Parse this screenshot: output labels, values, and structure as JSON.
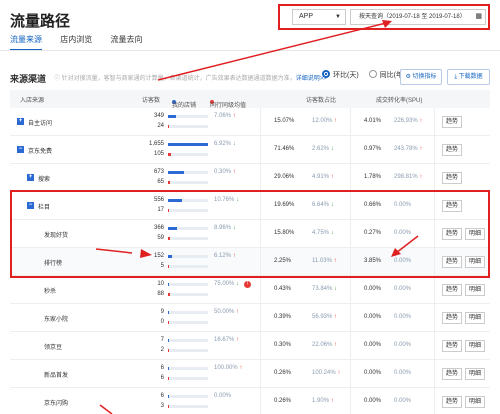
{
  "page_title": "流量路径",
  "top_controls": {
    "app_select": "APP",
    "date_range": "按天查询（2019-07-18 至 2019-07-18）"
  },
  "tabs": [
    {
      "label": "流量来源",
      "active": true
    },
    {
      "label": "店内浏览",
      "active": false
    },
    {
      "label": "流量去向",
      "active": false
    }
  ],
  "source_section": {
    "title": "来源渠道",
    "desc": "针对对搜流量，客智与商家通的计算量，各渠道统计，广告效果表达数据通道数据为准，",
    "link": "详细说明>>",
    "radio_daily": "环比(天)",
    "radio_weekly": "同比(年)",
    "btn_switch": "切换指标",
    "btn_download": "下载数据"
  },
  "table": {
    "headers": {
      "source": "入店来源",
      "visitors": "访客数",
      "legend_mine": "我的店铺",
      "legend_peer": "同行同级均值",
      "ratio": "访客数占比",
      "conversion": "成交转化率(SPU)"
    },
    "rows": [
      {
        "name": "自主访问",
        "toggle": "+",
        "mine": "349",
        "peer": "24",
        "mine_frac": 0.21,
        "peer_frac": 0.02,
        "change": "7.06%",
        "dir": "up",
        "ratio": "15.07%",
        "ratio_chg": "12.00%",
        "ratio_dir": "up",
        "conv": "4.01%",
        "conv_chg": "226.93%",
        "conv_dir": "up",
        "btn1": "趋势",
        "btn2": ""
      },
      {
        "name": "京东免费",
        "toggle": "−",
        "mine": "1,655",
        "peer": "105",
        "mine_frac": 1.0,
        "peer_frac": 0.07,
        "change": "6.92%",
        "dir": "down",
        "ratio": "71.46%",
        "ratio_chg": "2.62%",
        "ratio_dir": "down",
        "conv": "0.97%",
        "conv_chg": "243.78%",
        "conv_dir": "up",
        "btn1": "趋势",
        "btn2": ""
      },
      {
        "name": "搜索",
        "toggle": "+",
        "mine": "673",
        "peer": "65",
        "mine_frac": 0.41,
        "peer_frac": 0.04,
        "change": "0.30%",
        "dir": "up",
        "ratio": "29.06%",
        "ratio_chg": "4.91%",
        "ratio_dir": "up",
        "conv": "1.78%",
        "conv_chg": "298.81%",
        "conv_dir": "up",
        "btn1": "趋势",
        "btn2": ""
      },
      {
        "name": "栏目",
        "toggle": "−",
        "mine": "556",
        "peer": "17",
        "mine_frac": 0.34,
        "peer_frac": 0.01,
        "change": "10.76%",
        "dir": "down",
        "ratio": "19.69%",
        "ratio_chg": "6.64%",
        "ratio_dir": "down",
        "conv": "0.66%",
        "conv_chg": "0.00%",
        "conv_dir": "",
        "btn1": "趋势",
        "btn2": ""
      },
      {
        "name": "发现好货",
        "toggle": "",
        "mine": "366",
        "peer": "59",
        "mine_frac": 0.22,
        "peer_frac": 0.04,
        "change": "8.96%",
        "dir": "down",
        "ratio": "15.80%",
        "ratio_chg": "4.75%",
        "ratio_dir": "down",
        "conv": "0.27%",
        "conv_chg": "0.00%",
        "conv_dir": "",
        "btn1": "趋势",
        "btn2": "明细"
      },
      {
        "name": "排行榜",
        "toggle": "",
        "mine": "152",
        "peer": "5",
        "mine_frac": 0.09,
        "peer_frac": 0.01,
        "change": "6.12%",
        "dir": "up",
        "ratio": "2.25%",
        "ratio_chg": "11.03%",
        "ratio_dir": "up",
        "conv": "3.85%",
        "conv_chg": "0.00%",
        "conv_dir": "",
        "btn1": "趋势",
        "btn2": "明细"
      },
      {
        "name": "秒杀",
        "toggle": "",
        "mine": "10",
        "peer": "88",
        "mine_frac": 0.01,
        "peer_frac": 0.05,
        "change": "75.00%",
        "dir": "down",
        "ratio": "0.43%",
        "ratio_chg": "73.84%",
        "ratio_dir": "down",
        "conv": "0.00%",
        "conv_chg": "0.00%",
        "conv_dir": "",
        "btn1": "趋势",
        "btn2": "明细"
      },
      {
        "name": "东家小院",
        "toggle": "",
        "mine": "9",
        "peer": "0",
        "mine_frac": 0.01,
        "peer_frac": 0.0,
        "change": "50.00%",
        "dir": "up",
        "ratio": "0.39%",
        "ratio_chg": "56.93%",
        "ratio_dir": "up",
        "conv": "0.00%",
        "conv_chg": "0.00%",
        "conv_dir": "",
        "btn1": "趋势",
        "btn2": "明细"
      },
      {
        "name": "领京豆",
        "toggle": "",
        "mine": "7",
        "peer": "2",
        "mine_frac": 0.005,
        "peer_frac": 0.002,
        "change": "16.67%",
        "dir": "up",
        "ratio": "0.30%",
        "ratio_chg": "22.06%",
        "ratio_dir": "up",
        "conv": "0.00%",
        "conv_chg": "0.00%",
        "conv_dir": "",
        "btn1": "趋势",
        "btn2": "明细"
      },
      {
        "name": "新品首发",
        "toggle": "",
        "mine": "6",
        "peer": "6",
        "mine_frac": 0.004,
        "peer_frac": 0.004,
        "change": "100.00%",
        "dir": "up",
        "ratio": "0.26%",
        "ratio_chg": "100.24%",
        "ratio_dir": "up",
        "conv": "0.00%",
        "conv_chg": "0.00%",
        "conv_dir": "",
        "btn1": "趋势",
        "btn2": "明细"
      },
      {
        "name": "京东闪购",
        "toggle": "",
        "mine": "6",
        "peer": "3",
        "mine_frac": 0.004,
        "peer_frac": 0.002,
        "change": "0.00%",
        "dir": "",
        "ratio": "0.26%",
        "ratio_chg": "1.90%",
        "ratio_dir": "up",
        "conv": "0.00%",
        "conv_chg": "0.00%",
        "conv_dir": "",
        "btn1": "趋势",
        "btn2": "明细"
      }
    ]
  },
  "colors": {
    "accent": "#1565c0",
    "mine_bar": "#2c6ad3",
    "peer_bar": "#e53935",
    "annotation": "#e02020"
  }
}
